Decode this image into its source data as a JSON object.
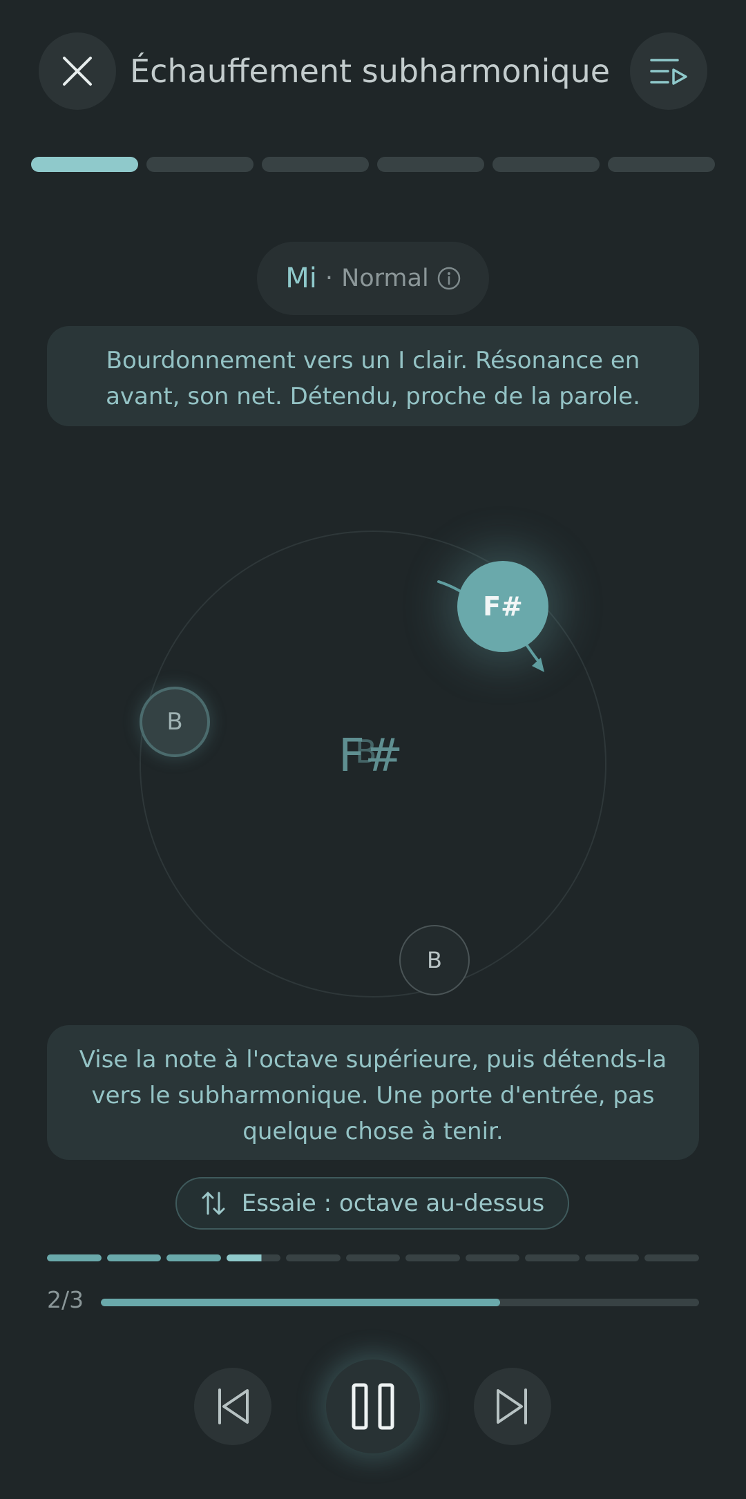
{
  "header": {
    "title": "Échauffement subharmonique",
    "close_icon": "close-icon",
    "playlist_icon": "playlist-icon"
  },
  "steps": {
    "total": 6,
    "current": 1
  },
  "voice": {
    "name": "Mi",
    "separator": "·",
    "mode": "Normal",
    "info_icon": "info-icon"
  },
  "instruction_top": "Bourdonnement vers un I clair. Résonance en avant, son net. Détendu, proche de la parole.",
  "stage": {
    "main_note": "F#",
    "note_left": "B",
    "note_bottom": "B",
    "center_note_a": "F#",
    "center_note_b": "B"
  },
  "instruction_bottom": "Vise la note à l'octave supérieure, puis détends-la vers le subharmonique. Une porte d'entrée, pas quelque chose à tenir.",
  "suggestion": {
    "label": "Essaie : octave au-dessus",
    "icon": "swap-vertical-icon"
  },
  "segments": {
    "total": 11,
    "done": 3,
    "partial_fraction": 0.65
  },
  "progress": {
    "label": "2/3",
    "fraction": 0.667
  },
  "controls": {
    "previous_icon": "skip-previous-icon",
    "pause_icon": "pause-icon",
    "next_icon": "skip-next-icon"
  },
  "colors": {
    "accent": "#8fc9cb",
    "accent_dark": "#6aa9ab",
    "background": "#1f2628"
  }
}
